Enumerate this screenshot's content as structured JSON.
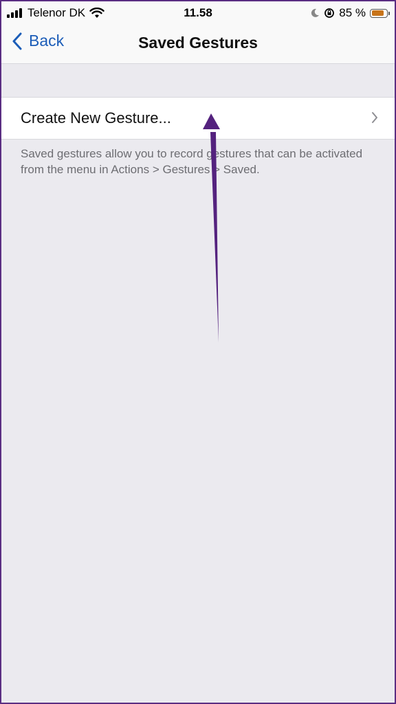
{
  "status_bar": {
    "carrier": "Telenor DK",
    "time": "11.58",
    "battery": "85 %",
    "battery_level": 0.85,
    "icons": [
      "signal-icon",
      "wifi-icon",
      "moon-icon",
      "rotation-lock-icon",
      "battery-icon"
    ]
  },
  "nav": {
    "back_label": "Back",
    "title": "Saved Gestures"
  },
  "list": {
    "create_label": "Create New Gesture..."
  },
  "footer": {
    "text": "Saved gestures allow you to record gestures that can be activated from the menu in Actions > Gestures > Saved."
  },
  "colors": {
    "accent": "#1c5db8",
    "annotation_arrow": "#54227e",
    "background": "#ebeaef",
    "battery": "#c8741a"
  }
}
